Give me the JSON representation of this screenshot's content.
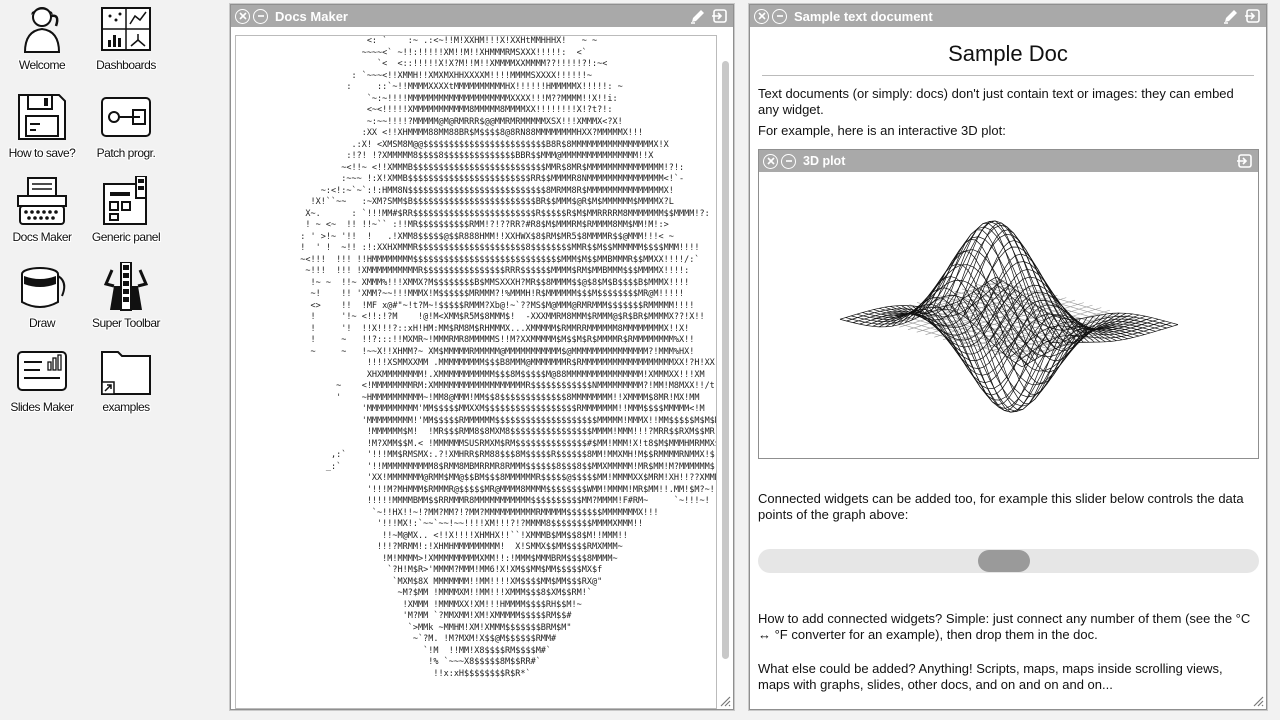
{
  "desktop": {
    "icons": [
      {
        "label": "Welcome",
        "icon": "person-icon"
      },
      {
        "label": "Dashboards",
        "icon": "dashboard-icon"
      },
      {
        "label": "How to save?",
        "icon": "floppy-disk-icon"
      },
      {
        "label": "Patch progr.",
        "icon": "patch-icon"
      },
      {
        "label": "Docs Maker",
        "icon": "typewriter-icon"
      },
      {
        "label": "Generic panel",
        "icon": "panel-icon"
      },
      {
        "label": "Draw",
        "icon": "paint-bucket-icon"
      },
      {
        "label": "Super Toolbar",
        "icon": "superhero-icon"
      },
      {
        "label": "Slides Maker",
        "icon": "slides-icon"
      },
      {
        "label": "examples",
        "icon": "folder-icon"
      }
    ]
  },
  "docs_maker": {
    "title": "Docs Maker",
    "ascii_art": "                        <: `    :~ .:<~!!M!XXHM!!!X!XXHtMMHHHX!   ~ ~\n                       ~~~~<` ~!!:!!!!!XM!!M!!XHMMMRMSXXX!!!!!:  <`\n                          `<  <::!!!!!X!X?M!!M!!XMMMMXXMMMM??!!!!!?!:~<\n                     : `~~~<!!XMMH!!XMXMXHHXXXXM!!!!MMMMSXXXX!!!!!!~\n                    :     ::`~!!MMMMXXXXtMMMMMMMMMMHX!!!!!!HMMMMMX!!!!!: ~\n                        `~:~!!!!MMMMMMMMMMMMMMMMMMMMXXXX!!!M??MMMM!!X!!i:\n                        <~<!!!!!XMMMMMMMMMMM8MMMMM8MMMMXX!!!!!!!!X!?t?!:\n                        ~:~~!!!!?MMMMM@M@RMRRR$@@MMRMRMMMMMXSX!!!XMMMX<?X!\n                       :XX <!!XHMMMM88MM88BR$M$$$$8@8RN88MMMMMMMMHXX?MMMMMX!!!\n                     .:X! <XMSM8M@@$$$$$$$$$$$$$$$$$$$$$$$$B8R$8MMMMMMMMMMMMMMMMX!X\n                    :!?! !?XMMMMM8$$$$8$$$$$$$$$$$$$$BBR$$MMM@MMMMMMMMMMMMMMM!!X\n                   ~<!!~ <!!XMMMB$$$$$$$$$$$$$$$$$$$$$$$$$$MMR$8MR$MMMMMMMMMMMMMMM!?!:\n                   :~~~ !:X!XMMB$$$$$$$$$$$$$$$$$$$$$$$$RR$$MMMMR8NMMMMMMMMMMMMMMM<!`-\n               ~:<!:~`~`:!:HMM8N$$$$$$$$$$$$$$$$$$$$$$$$$$$8MRMM8R$MMMMMMMMMMMMMMMX!\n             !X!``~~   :~XM?SMM$B$$$$$$$$$$$$$$$$$$$$$$$$BR$$MMM$@R$M$MMMMMM$MMMMX?L\n            X~.      : `!!!MM#$RR$$$$$$$$$$$$$$$$$$$$$$$$R$$$$$R$M$MMRRRRM8MMMMMMM$$MMMM!?:\n            ! ~ <~  !! !!~`` :!!MR$$$$$$$$$$RMM!?!??RR?#R8$M$MMMRM$RMMMM8MM$MM!M!:>\n           : ' >!~ '!!  !   .!XMM8$$$$$@$$R888HMM!!XXHWX$8$RM$MR5$8MMMMR$$@MMM!!!< ~\n           !  ' !  ~!! :!:XXHXMMMR$$$$$$$$$$$$$$$$$$$$$8$$$$$$$$MMR$$M$$MMMMMM$$$$MMM!!!!\n           ~<!!!  !!! !!HMMMMMMMM$$$$$$$$$$$$$$$$$$$$$$$$$$$$$MMM$M$$MMBMMMR$$MMXX!!!!/:`\n            ~!!!  !!! !XMMMMMMMMMMR$$$$$$$$$$$$$$$$RRR$$$$$$MMMM$RM$MMBMMM$$$MMMMX!!!!:\n             !~ ~  !!~ XMMM%!!!XMMX?M$$$$$$$$B$MMSXXXH?MR$$8MMMM$$@$8$M$B$$$$B$MMMX!!!!\n             ~!    !! 'XMM?~~!!!MMMX!M$$$$$$MRMMM?!%MMMH!R$MMMMMM$$$M$$$$$$$$MR@M!!!!!\n             <>    !!  !MF x@#\"~!t?M~!$$$$$RMMM?Xb@!~`??MS$M@MMM@RMRMMM$$$$$$$RMMMMM!!!!\n             !     '!~ <!!:!?M    !@!M<XMM$R5M$8MMM$!  -XXXMMRM8MMM$RMMM@$R$BR$MMMMX??!X!!\n             !     '!  !!X!!!?::xH!HM:MM$RM8M$RHMMMX...XMMMMM$RMMRRMMMMMM8MMMMMMMMX!!X!\n             !     ~   !!?:::!!MXMR~!MMMRMR8MMMMMS!!M?XXMMMMM$M$$M$R$MMMMR$RMMMMMMMM%X!!\n             ~     ~   !~~X!!XHMM?~ XM$MMMMMRMMMMM@MMMMMMMMMMM$@MMMMMMMMMMMMMMM?!MMM%HX!\n                        !!!!XSMMXXMM .MMMMMMMMM$$$B8MMM@MMMMMMMR$RMMMMMMMMMMMMMMMMMMXX!?H!XX\n                        XHXMMMMMMMM!.XMMMMMMMMMMM$$$8M$$$$$M@88MMMMMMMMMMMMMMM!XMMMXX!!!XM\n                  ~    <!MMMMMMMMRM:XMMMMMMMMMMMMMMMMMMR$$$$$$$$$$$$NMMMMMMMMM?!MM!M8MXX!!/t!M\n                  '    ~HMMMMMMMMMM~!MM8@MMM!MM$$8$$$$$$$$$$$$$8MMMMMMMM!!XMMMM$8MR!MX!MM\n                       'MMMMMMMMMM'MM$$$$$MMXXM$$$$$$$$$$$$$$$$$$RMMMMMMM!!MMM$$$$MMMMM<!M\n                       'MMMMMMMMM!'MM$$$$$RMMMMMM$$$$$$$$$$$$$$$$$$$$MMMMM!MMMX!!MM$$$$$M$M$M!M\n                        !MMMMMM$M!  !MR$$$RMM8$8MXM8$$$$$$$$$$$$$$$$MMMM!MMM!!!?MRR$$RXM$$MR!M\n                        !M?XMM$$M.< !MMMMMMSUSRMXM$RM$$$$$$$$$$$$$$#$MM!MMM!X!t8$M$MMMHMRMMX$\n                 ,:`    '!!!MM$RMSMX:.?!XMHRR$RM88$$$8M$$$$$R$$$$$$8MM!MMXMH!M$$RMMMMRNMMX!$\n                _:`     '!!MMMMMMMMMM8$RMM8MBMRRMR8RMMM$$$$$$8$$$8$$MMXMMMMM!MR$MM!M?MMMMMM$\n                        'XX!MMMMMMM@RMM$MM@$$BM$$$8MMMMMMR$$$$$@$$$$$MM!MMMMXX$MRM!XH!!??XMMM\n                        '!!!M?MHMMM$RMMMR@$$$$$MR@MMMM8MMMM$$$$$$$$WMM!MMMM!MR$MM!!.MM!$M?~!\n                        !!!!!MMMMBMM$$RRMMMR8MMMMMMMMMMM$$$$$$$$$$MM?MMMM!F#RM~     `~!!!~!\n                         `~!!HX!!~!?MM?MM?!?MM?MMMMMMMMMMRMMMMM$$$$$$$MMMMMMMX!!!\n                          '!!!MX!:`~~`~~!~~!!!!XM!!!?!?MMMM8$$$$$$$$MMMMXMMM!!\n                           !!~M@MX.. <!!X!!!!XHMHX!!``!XMMMB$MM$$8$M!!MMM!!\n                          !!!?MRMM!:!XHMHMMMMMMMMM!  X!SMMX$$MM$$$$RMXMMM~\n                           !M!MMMM>!XMMMMMMMMMXMM!!:!MMM$MMMBRM$$$$8MMMM~\n                            `?H!M$R>'MMMM?MMM!MM6!X!XM$$MM$MM$$$$$MX$f\n                             `MXM$8X MMMMMMM!!MM!!!!XM$$$$MM$MM$$$RX@\"\n                              ~M?$MM !MMMMXM!!MM!!!XMMM$$$8$XM$$RM!`\n                               !XMMM !MMMMXX!XM!!!HMMMM$$$$RH$$M!~\n                               'M?MM `?MMXMM!XM!XMMMMM$$$$$RM$$#\n                                `>MMk ~MMHM!XM!XMMM$$$$$$$BRM$M\"\n                                 ~`?M. !M?MXM!X$$@M$$$$$$RMM#\n                                   `!M  !!MM!X8$$$$RM$$$$M#`\n                                    !% `~~~X8$$$$$8M$$RR#`\n                                     !!x:xH$$$$$$$$R$R*`"
  },
  "sample_doc": {
    "title": "Sample text document",
    "heading": "Sample Doc",
    "p1": "Text documents (or simply: docs) don't just contain text or images: they can embed any widget.",
    "p2": "For example, here is an interactive 3D plot:",
    "plot_title": "3D plot",
    "p3": "Connected widgets can be added too, for example this slider below controls the data points of the graph above:",
    "p4": "How to add connected widgets? Simple: just connect any number of them (see the °C ↔ °F converter for an example), then drop them in the doc.",
    "p5": "What else could be added? Anything! Scripts, maps, maps inside scrolling views, maps with graphs, slides, other docs, and on and on and on...",
    "slider_value": 0.49
  }
}
